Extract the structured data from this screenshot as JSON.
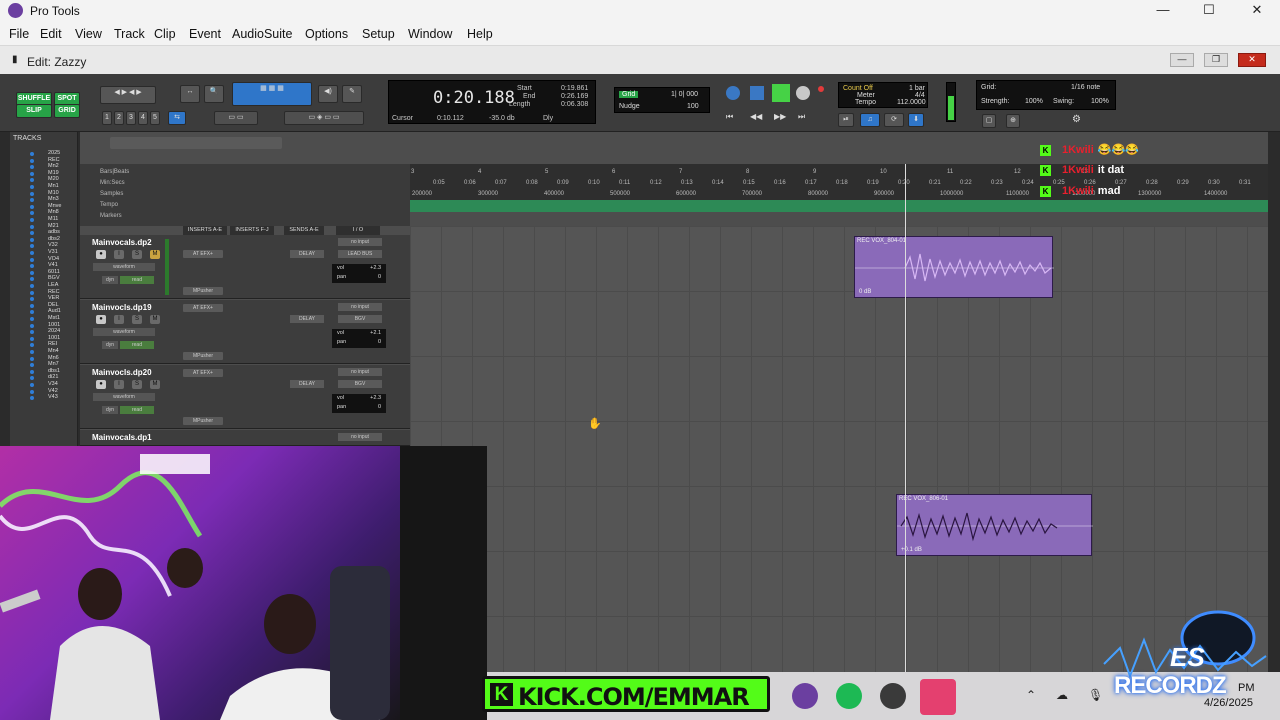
{
  "window": {
    "app_title": "Pro Tools",
    "edit_title": "Edit: Zazzy"
  },
  "menu": [
    "File",
    "Edit",
    "View",
    "Track",
    "Clip",
    "Event",
    "AudioSuite",
    "Options",
    "Setup",
    "Window",
    "Help"
  ],
  "toolbar": {
    "modes": [
      "SHUFFLE",
      "SPOT",
      "SLIP",
      "GRID"
    ],
    "zoom_presets": [
      "1",
      "2",
      "3",
      "4",
      "5"
    ],
    "counter_main": "0:20.188",
    "start_label": "Start",
    "start_value": "0:19.861",
    "end_label": "End",
    "end_value": "0:26.169",
    "length_label": "Length",
    "length_value": "0:06.308",
    "cursor_label": "Cursor",
    "cursor_value": "0:10.112",
    "cursor_db": "-35.0 db",
    "dly_label": "Dly",
    "grid_label": "Grid",
    "grid_value": "1| 0| 000",
    "nudge_label": "Nudge",
    "nudge_value": "100",
    "count_off": "Count Off",
    "meter": "Meter",
    "tempo": "Tempo",
    "bar_value": "1 bar",
    "meter_value": "4/4",
    "tempo_value": "112.0000",
    "grid_right_label": "Grid:",
    "grid_right_value": "1/16 note",
    "strength_label": "Strength:",
    "strength_value": "100%",
    "swing_label": "Swing:",
    "swing_value": "100%"
  },
  "tracks_list": {
    "header": "TRACKS",
    "items": [
      "2025",
      "REC",
      "Mn2",
      "M19",
      "M20",
      "Mn1",
      "M10",
      "Mn3",
      "Mnve",
      "Mn8",
      "M11",
      "M21",
      "adbs",
      "dbs2",
      "V32",
      "V31",
      "VO4",
      "V41",
      "6011",
      "BGV",
      "LEA",
      "REC",
      "VER",
      "DEL",
      "Aud1",
      "Mst1",
      "1001",
      "2024",
      "1001",
      "REI",
      "Mn4",
      "Mn6",
      "Mn7",
      "dbs1",
      "di21",
      "V34",
      "V42",
      "V43"
    ]
  },
  "rulers": {
    "labels": [
      "Bars|Beats",
      "Min:Secs",
      "Samples",
      "Tempo",
      "Markers"
    ],
    "bar_ticks": [
      "3",
      "4",
      "5",
      "6",
      "7",
      "8",
      "9",
      "10",
      "11",
      "12",
      "13"
    ],
    "min_ticks": [
      "0:05",
      "0:06",
      "0:07",
      "0:08",
      "0:09",
      "0:10",
      "0:11",
      "0:12",
      "0:13",
      "0:14",
      "0:15",
      "0:16",
      "0:17",
      "0:18",
      "0:19",
      "0:20",
      "0:21",
      "0:22",
      "0:23",
      "0:24",
      "0:25",
      "0:26",
      "0:27",
      "0:28",
      "0:29",
      "0:30",
      "0:31"
    ],
    "sample_ticks": [
      "200000",
      "300000",
      "400000",
      "500000",
      "600000",
      "700000",
      "800000",
      "900000",
      "1000000",
      "1100000",
      "1200000",
      "1300000",
      "1400000"
    ]
  },
  "columns": {
    "inserts_ae": "INSERTS A-E",
    "inserts_fj": "INSERTS F-J",
    "sends_ae": "SENDS A-E",
    "io": "I / O"
  },
  "tracks": [
    {
      "name": "Mainvocals.dp2",
      "insert": "AT EFX+",
      "plugin": "MPusher",
      "send": "DELAY",
      "input": "no input",
      "output": "LEAD BUS",
      "vol": "+2.3",
      "pan": "0",
      "view": "waveform",
      "auto": "read",
      "dyn": "dyn"
    },
    {
      "name": "Mainvocls.dp19",
      "insert": "AT EFX+",
      "plugin": "MPusher",
      "send": "DELAY",
      "input": "no input",
      "output": "BGV",
      "vol": "+2.1",
      "pan": "0",
      "view": "waveform",
      "auto": "read",
      "dyn": "dyn"
    },
    {
      "name": "Mainvocls.dp20",
      "insert": "AT EFX+",
      "plugin": "MPusher",
      "send": "DELAY",
      "input": "no input",
      "output": "BGV",
      "vol": "+2.3",
      "pan": "0",
      "view": "waveform",
      "auto": "read",
      "dyn": "dyn"
    },
    {
      "name": "Mainvocals.dp1",
      "input": "no input"
    }
  ],
  "clips": [
    {
      "title": "REC VOX_804-01",
      "gain": "0 dB"
    },
    {
      "title": "REC VOX_806-01",
      "gain": "+0.1 dB"
    }
  ],
  "chat": [
    {
      "user": "1Kwili",
      "msg": "😂😂😂"
    },
    {
      "user": "1Kwili",
      "msg": "it dat"
    },
    {
      "user": "1Kwili",
      "msg": "mad"
    }
  ],
  "overlay": {
    "kick_text": "KICK.COM/EMMAR",
    "watermark": "RECORDZ",
    "watermark_small": "ES"
  },
  "tray": {
    "time": "PM",
    "date": "4/26/2025"
  },
  "colors": {
    "accent_green": "#53fc18",
    "clip_purple": "#8a6ab9",
    "marker_green": "#2d8a56",
    "pro_tools_purple": "#6b3fa0"
  }
}
